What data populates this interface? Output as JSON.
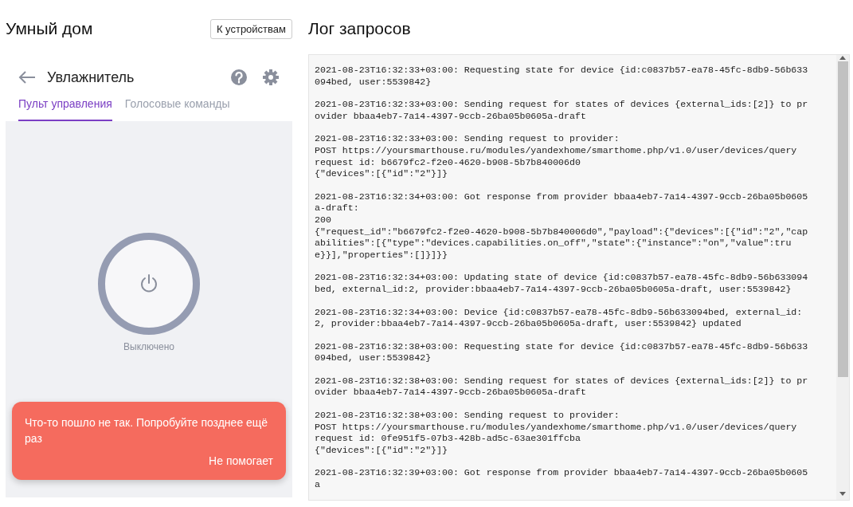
{
  "app": {
    "title": "Умный дом",
    "devices_button": "К устройствам"
  },
  "device": {
    "name": "Увлажнитель",
    "tabs": [
      {
        "label": "Пульт управления",
        "selected": true
      },
      {
        "label": "Голосовые команды",
        "selected": false
      }
    ],
    "power": {
      "on": false,
      "status": "Выключено"
    },
    "toast": {
      "message": "Что-то пошло не так. Попробуйте позднее ещё раз",
      "action": "Не помогает"
    }
  },
  "log": {
    "title": "Лог запросов",
    "entries": [
      "2021-08-23T16:32:33+03:00: Requesting state for device {id:c0837b57-ea78-45fc-8db9-56b633094bed, user:5539842}",
      "2021-08-23T16:32:33+03:00: Sending request for states of devices {external_ids:[2]} to provider bbaa4eb7-7a14-4397-9ccb-26ba05b0605a-draft",
      "2021-08-23T16:32:33+03:00: Sending request to provider:\nPOST https://yoursmarthouse.ru/modules/yandexhome/smarthome.php/v1.0/user/devices/query\nrequest id: b6679fc2-f2e0-4620-b908-5b7b840006d0\n{\"devices\":[{\"id\":\"2\"}]}",
      "2021-08-23T16:32:34+03:00: Got response from provider bbaa4eb7-7a14-4397-9ccb-26ba05b0605a-draft:\n200\n{\"request_id\":\"b6679fc2-f2e0-4620-b908-5b7b840006d0\",\"payload\":{\"devices\":[{\"id\":\"2\",\"capabilities\":[{\"type\":\"devices.capabilities.on_off\",\"state\":{\"instance\":\"on\",\"value\":true}}],\"properties\":[]}]}}",
      "2021-08-23T16:32:34+03:00: Updating state of device {id:c0837b57-ea78-45fc-8db9-56b633094bed, external_id:2, provider:bbaa4eb7-7a14-4397-9ccb-26ba05b0605a-draft, user:5539842}",
      "2021-08-23T16:32:34+03:00: Device {id:c0837b57-ea78-45fc-8db9-56b633094bed, external_id:2, provider:bbaa4eb7-7a14-4397-9ccb-26ba05b0605a-draft, user:5539842} updated",
      "2021-08-23T16:32:38+03:00: Requesting state for device {id:c0837b57-ea78-45fc-8db9-56b633094bed, user:5539842}",
      "2021-08-23T16:32:38+03:00: Sending request for states of devices {external_ids:[2]} to provider bbaa4eb7-7a14-4397-9ccb-26ba05b0605a-draft",
      "2021-08-23T16:32:38+03:00: Sending request to provider:\nPOST https://yoursmarthouse.ru/modules/yandexhome/smarthome.php/v1.0/user/devices/query\nrequest id: 0fe951f5-07b3-428b-ad5c-63ae301ffcba\n{\"devices\":[{\"id\":\"2\"}]}",
      "2021-08-23T16:32:39+03:00: Got response from provider bbaa4eb7-7a14-4397-9ccb-26ba05b0605a"
    ]
  }
}
